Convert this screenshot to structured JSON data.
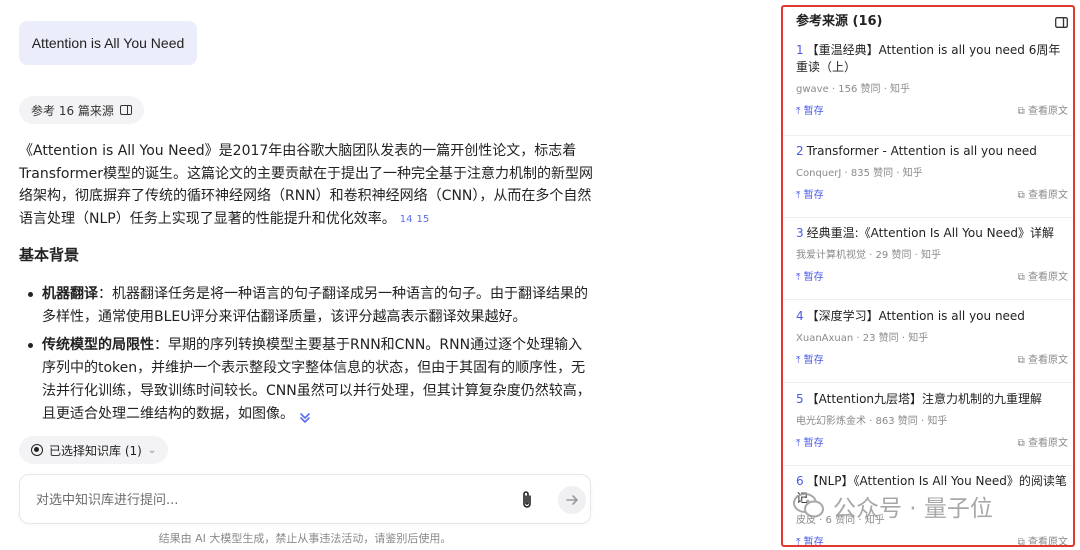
{
  "chat": {
    "query": "Attention is All You Need",
    "refs_chip": "参考 16 篇来源",
    "answer_para": "《Attention is All You Need》是2017年由谷歌大脑团队发表的一篇开创性论文，标志着Transformer模型的诞生。这篇论文的主要贡献在于提出了一种完全基于注意力机制的新型网络架构，彻底摒弃了传统的循环神经网络（RNN）和卷积神经网络（CNN），从而在多个自然语言处理（NLP）任务上实现了显著的性能提升和优化效率。",
    "citations": [
      "14",
      "15"
    ],
    "section_title": "基本背景",
    "bullets": [
      {
        "term": "机器翻译",
        "text": "：机器翻译任务是将一种语言的句子翻译成另一种语言的句子。由于翻译结果的多样性，通常使用BLEU评分来评估翻译质量，该评分越高表示翻译效果越好。"
      },
      {
        "term": "传统模型的局限性",
        "text": "：早期的序列转换模型主要基于RNN和CNN。RNN通过逐个处理输入序列中的token，并维护一个表示整段文字整体信息的状态，但由于其固有的顺序性，无法并行化训练，导致训练时间较长。CNN虽然可以并行处理，但其计算复杂度仍然较高，且更适合处理二维结构的数据，如图像。"
      }
    ],
    "kb_chip": "已选择知识库 (1)",
    "input_placeholder": "对选中知识库进行提问...",
    "disclaimer": "结果由 AI 大模型生成，禁止从事违法活动，请鉴别后使用。"
  },
  "sources": {
    "header": "参考来源 (16)",
    "pin_label": "暂存",
    "view_label": "查看原文",
    "items": [
      {
        "num": "1",
        "title": "【重温经典】Attention is all you need 6周年重读（上）",
        "meta": "gwave · 156 赞同 · 知乎"
      },
      {
        "num": "2",
        "title": "Transformer - Attention is all you need",
        "meta": "ConquerJ · 835 赞同 · 知乎"
      },
      {
        "num": "3",
        "title": "经典重温:《Attention Is All You Need》详解",
        "meta": "我爱计算机视觉 · 29 赞同 · 知乎"
      },
      {
        "num": "4",
        "title": "【深度学习】Attention is all you need",
        "meta": "XuanAxuan · 23 赞同 · 知乎"
      },
      {
        "num": "5",
        "title": "【Attention九层塔】注意力机制的九重理解",
        "meta": "电光幻影炼金术 · 863 赞同 · 知乎"
      },
      {
        "num": "6",
        "title": "【NLP】《Attention Is All You Need》的阅读笔记",
        "meta": "皮皮 · 6 赞同 · 知乎"
      }
    ]
  },
  "watermark": "公众号 · 量子位",
  "colors": {
    "accent": "#4a5ae8",
    "highlight_border": "#e0382c",
    "query_bg": "#ecedfb"
  }
}
